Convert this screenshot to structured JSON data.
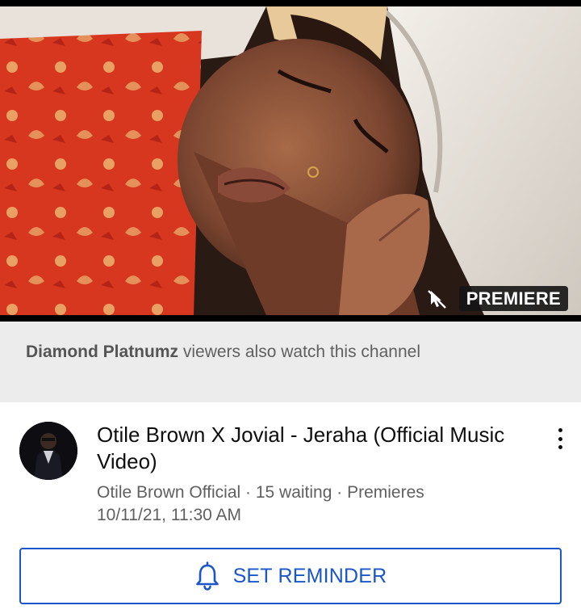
{
  "thumbnail": {
    "badge_label": "PREMIERE",
    "badge_icon": "no-cursor-icon"
  },
  "banner": {
    "channel_name": "Diamond Platnumz",
    "text": " viewers also watch this channel"
  },
  "video": {
    "title": "Otile Brown X Jovial - Jeraha (Official Music Video)",
    "channel": "Otile Brown Official",
    "separator": " · ",
    "waiting": "15 waiting",
    "premieres_label": "Premieres",
    "premiere_datetime": "10/11/21, 11:30 AM",
    "menu_icon": "more-vert-icon"
  },
  "reminder": {
    "label": "SET REMINDER",
    "icon": "bell-icon",
    "accent_color": "#1a56c9"
  }
}
